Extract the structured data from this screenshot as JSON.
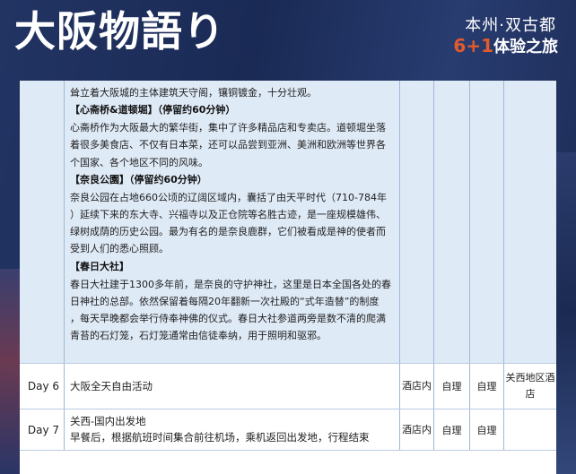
{
  "header": {
    "title": "大阪物語り",
    "subtitle_line1": "本州·双古都",
    "subtitle_accent": "6+1",
    "subtitle_line2_rest": "体验之旅"
  },
  "rows": [
    {
      "day": "",
      "blocks": [
        {
          "type": "text",
          "text": "耸立着大阪城的主体建筑天守阁，镶铜镀金，十分壮观。"
        },
        {
          "type": "head",
          "text": "【心斋桥&道顿堀】（停留约60分钟）"
        },
        {
          "type": "text",
          "text": "心斋桥作为大阪最大的繁华街，集中了许多精品店和专卖店。道顿堀坐落"
        },
        {
          "type": "text",
          "text": "着很多美食店、不仅有日本菜，还可以品尝到亚洲、美洲和欧洲等世界各"
        },
        {
          "type": "text",
          "text": "个国家、各个地区不同的风味。"
        },
        {
          "type": "head",
          "text": "【奈良公園】（停留约60分钟）"
        },
        {
          "type": "text",
          "text": "奈良公园在占地660公顷的辽阔区域内，囊括了由天平时代（710-784年"
        },
        {
          "type": "text",
          "text": "）延续下来的东大寺、兴福寺以及正仓院等名胜古迹，是一座规模雄伟、"
        },
        {
          "type": "text",
          "text": "绿树成荫的历史公园。最为有名的是奈良鹿群，它们被看成是神的使者而"
        },
        {
          "type": "text",
          "text": "受到人们的悉心照顾。"
        },
        {
          "type": "head",
          "text": "【春日大社】"
        },
        {
          "type": "text",
          "text": "春日大社建于1300多年前，是奈良的守护神社，这里是日本全国各处的春"
        },
        {
          "type": "text",
          "text": "日神社的总部。依然保留着每隔20年翻新一次社殿的“式年造替”的制度"
        },
        {
          "type": "text",
          "text": "，每天早晚都会举行侍奉神佛的仪式。春日大社参道两旁是数不清的爬满"
        },
        {
          "type": "text",
          "text": "青苔的石灯笼，石灯笼通常由信徒奉纳，用于照明和驱邪。"
        }
      ],
      "breakfast": "",
      "lunch": "",
      "dinner": "",
      "hotel": ""
    },
    {
      "day": "Day 6",
      "title": "大阪全天自由活动",
      "detail": "",
      "breakfast": "酒店内",
      "lunch": "自理",
      "dinner": "自理",
      "hotel": "关西地区酒店"
    },
    {
      "day": "Day 7",
      "title": "关西-国内出发地",
      "detail": "早餐后，根据航班时间集合前往机场，乘机返回出发地，行程结束",
      "breakfast": "酒店内",
      "lunch": "自理",
      "dinner": "自理",
      "hotel": ""
    }
  ],
  "colors": {
    "background": "#1c2a4e",
    "shaded_row": "#dfeaf7",
    "accent": "#e35a2b",
    "border": "#9fb8d6"
  }
}
